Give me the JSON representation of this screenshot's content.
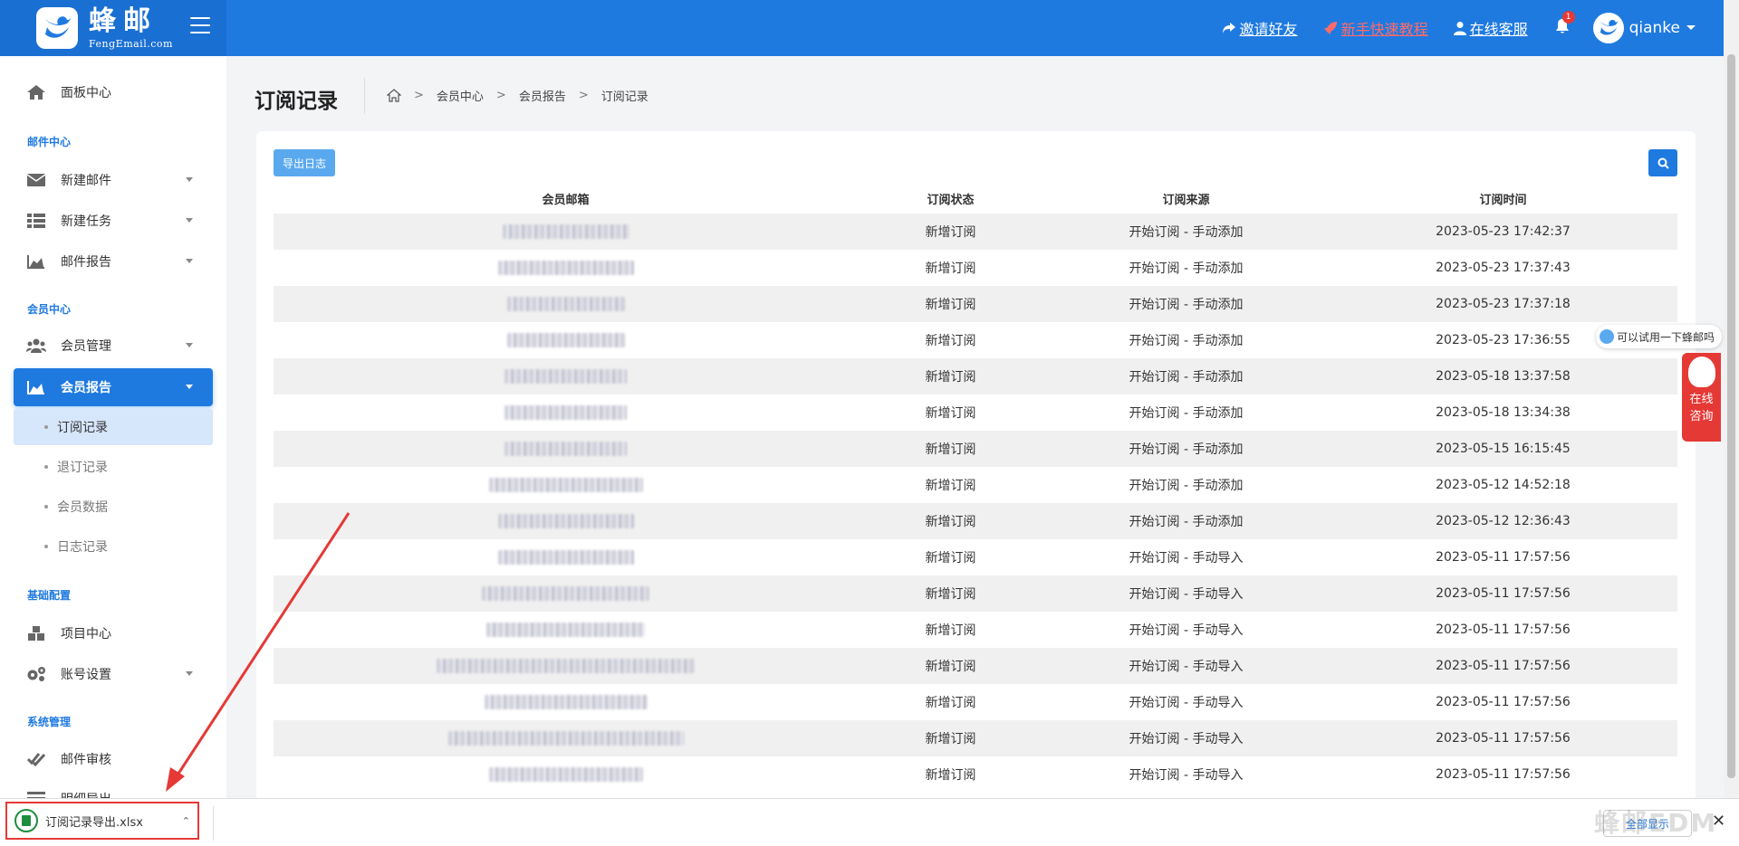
{
  "header": {
    "brand_cn": "蜂邮",
    "brand_en": "FengEmail.com",
    "links": [
      {
        "label": "邀请好友",
        "icon": "share-icon"
      },
      {
        "label": "新手快速教程",
        "icon": "rocket-icon"
      },
      {
        "label": "在线客服",
        "icon": "user-icon"
      }
    ],
    "notifications": "1",
    "username": "qianke"
  },
  "sidebar": {
    "dashboard": "面板中心",
    "sections": {
      "mail": "邮件中心",
      "member": "会员中心",
      "base": "基础配置",
      "system": "系统管理"
    },
    "mail_items": [
      "新建邮件",
      "新建任务",
      "邮件报告"
    ],
    "member_items": [
      "会员管理",
      "会员报告"
    ],
    "member_report_sub": [
      "订阅记录",
      "退订记录",
      "会员数据",
      "日志记录"
    ],
    "base_items": [
      "项目中心",
      "账号设置"
    ],
    "system_items": [
      "邮件审核",
      "明细导出"
    ]
  },
  "page": {
    "title": "订阅记录",
    "breadcrumb": [
      "会员中心",
      "会员报告",
      "订阅记录"
    ]
  },
  "toolbar": {
    "export_label": "导出日志"
  },
  "table": {
    "columns": [
      "会员邮箱",
      "订阅状态",
      "订阅来源",
      "订阅时间"
    ],
    "rows": [
      {
        "status": "新增订阅",
        "source": "开始订阅 - 手动添加",
        "time": "2023-05-23 17:42:37"
      },
      {
        "status": "新增订阅",
        "source": "开始订阅 - 手动添加",
        "time": "2023-05-23 17:37:43"
      },
      {
        "status": "新增订阅",
        "source": "开始订阅 - 手动添加",
        "time": "2023-05-23 17:37:18"
      },
      {
        "status": "新增订阅",
        "source": "开始订阅 - 手动添加",
        "time": "2023-05-23 17:36:55"
      },
      {
        "status": "新增订阅",
        "source": "开始订阅 - 手动添加",
        "time": "2023-05-18 13:37:58"
      },
      {
        "status": "新增订阅",
        "source": "开始订阅 - 手动添加",
        "time": "2023-05-18 13:34:38"
      },
      {
        "status": "新增订阅",
        "source": "开始订阅 - 手动添加",
        "time": "2023-05-15 16:15:45"
      },
      {
        "status": "新增订阅",
        "source": "开始订阅 - 手动添加",
        "time": "2023-05-12 14:52:18"
      },
      {
        "status": "新增订阅",
        "source": "开始订阅 - 手动添加",
        "time": "2023-05-12 12:36:43"
      },
      {
        "status": "新增订阅",
        "source": "开始订阅 - 手动导入",
        "time": "2023-05-11 17:57:56"
      },
      {
        "status": "新增订阅",
        "source": "开始订阅 - 手动导入",
        "time": "2023-05-11 17:57:56"
      },
      {
        "status": "新增订阅",
        "source": "开始订阅 - 手动导入",
        "time": "2023-05-11 17:57:56"
      },
      {
        "status": "新增订阅",
        "source": "开始订阅 - 手动导入",
        "time": "2023-05-11 17:57:56"
      },
      {
        "status": "新增订阅",
        "source": "开始订阅 - 手动导入",
        "time": "2023-05-11 17:57:56"
      },
      {
        "status": "新增订阅",
        "source": "开始订阅 - 手动导入",
        "time": "2023-05-11 17:57:56"
      },
      {
        "status": "新增订阅",
        "source": "开始订阅 - 手动导入",
        "time": "2023-05-11 17:57:56"
      }
    ]
  },
  "widgets": {
    "try_text": "可以试用一下蜂邮吗",
    "consult_line1": "在线",
    "consult_line2": "咨询"
  },
  "downloads": {
    "file_name": "订阅记录导出.xlsx",
    "show_all": "全部显示",
    "watermark": "蜂邮EDM"
  },
  "colors": {
    "primary": "#1f7ae0",
    "header_logo_bg": "#1a6fd2",
    "annotation_red": "#e53935"
  }
}
